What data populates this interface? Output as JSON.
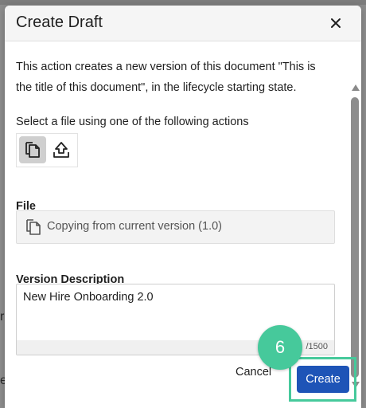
{
  "background": {
    "fragment_r": "r",
    "fragment_e": "e"
  },
  "dialog": {
    "title": "Create Draft",
    "description": "This action creates a new version of this document \"This is the title of this document\", in the lifecycle starting state.",
    "select_label": "Select a file using one of the following actions",
    "actions": [
      {
        "name": "copy-current-version",
        "icon": "copy-icon",
        "selected": true
      },
      {
        "name": "upload-file",
        "icon": "upload-icon",
        "selected": false
      }
    ],
    "file": {
      "label": "File",
      "value": "Copying from current version (1.0)"
    },
    "version_description": {
      "label": "Version Description",
      "value": "New Hire Onboarding 2.0",
      "counter": "/1500"
    },
    "buttons": {
      "cancel": "Cancel",
      "create": "Create"
    }
  },
  "step_badge": "6",
  "colors": {
    "primary": "#1e54b7",
    "highlight": "#46c99b"
  }
}
